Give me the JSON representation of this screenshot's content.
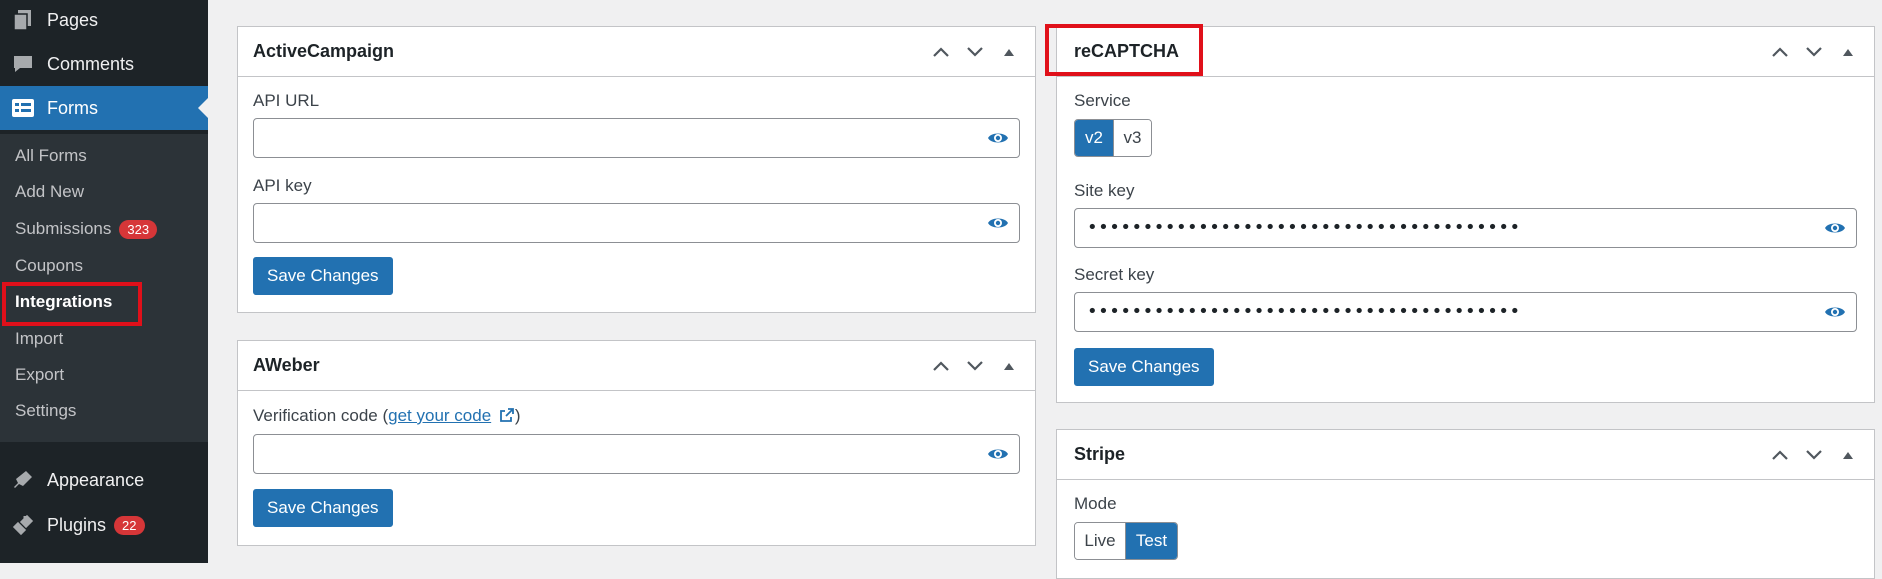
{
  "sidebar": {
    "items": [
      {
        "label": "Pages",
        "icon": "pages-icon"
      },
      {
        "label": "Comments",
        "icon": "comments-icon"
      },
      {
        "label": "Forms",
        "icon": "forms-icon"
      },
      {
        "label": "Appearance",
        "icon": "appearance-icon"
      },
      {
        "label": "Plugins",
        "icon": "plugins-icon",
        "badge": "22"
      }
    ],
    "submenu": [
      {
        "label": "All Forms"
      },
      {
        "label": "Add New"
      },
      {
        "label": "Submissions",
        "badge": "323"
      },
      {
        "label": "Coupons"
      },
      {
        "label": "Integrations"
      },
      {
        "label": "Import"
      },
      {
        "label": "Export"
      },
      {
        "label": "Settings"
      }
    ]
  },
  "panels": {
    "activecampaign": {
      "title": "ActiveCampaign",
      "api_url_label": "API URL",
      "api_key_label": "API key",
      "save": "Save Changes"
    },
    "aweber": {
      "title": "AWeber",
      "verification_label": "Verification code (",
      "link_text": "get your code",
      "close_paren": ")",
      "save": "Save Changes"
    },
    "recaptcha": {
      "title": "reCAPTCHA",
      "service_label": "Service",
      "service_options": [
        "v2",
        "v3"
      ],
      "service_selected": "v2",
      "site_key_label": "Site key",
      "site_key_value": "•••••••••••••••••••••••••••••••••••••••",
      "secret_key_label": "Secret key",
      "secret_key_value": "•••••••••••••••••••••••••••••••••••••••",
      "save": "Save Changes"
    },
    "stripe": {
      "title": "Stripe",
      "mode_label": "Mode",
      "mode_options": [
        "Live",
        "Test"
      ],
      "mode_selected": "Test"
    }
  },
  "colors": {
    "accent": "#2271b1",
    "sidebar_bg": "#1d2327",
    "badge": "#d63638",
    "highlight": "#e0101a"
  }
}
